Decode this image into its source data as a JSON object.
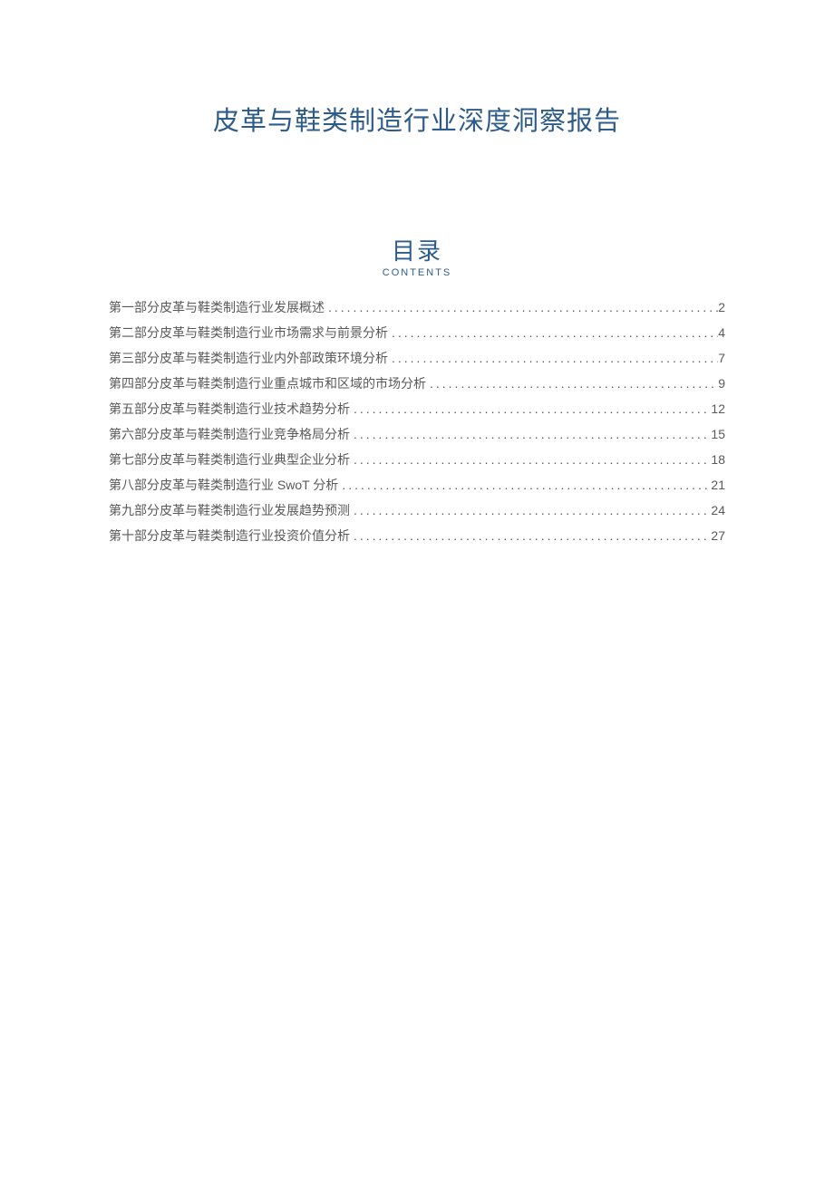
{
  "document": {
    "title": "皮革与鞋类制造行业深度洞察报告"
  },
  "toc": {
    "heading": "目录",
    "subheading": "CONTENTS",
    "entries": [
      {
        "label": "第一部分皮革与鞋类制造行业发展概述",
        "page": "2"
      },
      {
        "label": "第二部分皮革与鞋类制造行业市场需求与前景分析",
        "page": "4"
      },
      {
        "label": "第三部分皮革与鞋类制造行业内外部政策环境分析",
        "page": "7"
      },
      {
        "label": "第四部分皮革与鞋类制造行业重点城市和区域的市场分析",
        "page": "9"
      },
      {
        "label": "第五部分皮革与鞋类制造行业技术趋势分析",
        "page": "12"
      },
      {
        "label": "第六部分皮革与鞋类制造行业竞争格局分析",
        "page": "15"
      },
      {
        "label": "第七部分皮革与鞋类制造行业典型企业分析",
        "page": "18"
      },
      {
        "label": "第八部分皮革与鞋类制造行业 SwoT 分析",
        "page": "21"
      },
      {
        "label": "第九部分皮革与鞋类制造行业发展趋势预测",
        "page": "24"
      },
      {
        "label": "第十部分皮革与鞋类制造行业投资价值分析",
        "page": "27"
      }
    ]
  }
}
